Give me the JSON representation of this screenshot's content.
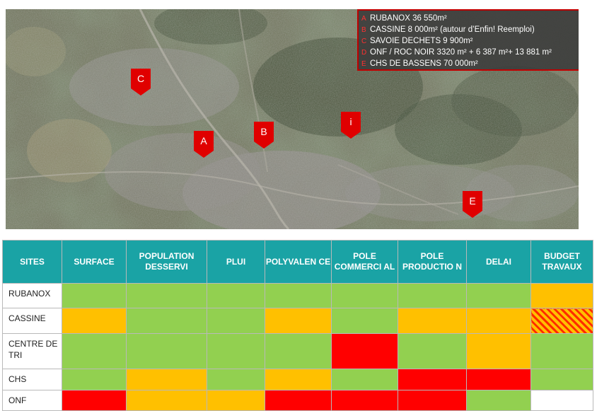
{
  "map": {
    "legend": [
      {
        "key": "A",
        "text": "RUBANOX 36 550m²"
      },
      {
        "key": "B",
        "text": "CASSINE 8 000m² (autour d’Enfin! Reemploi)"
      },
      {
        "key": "C",
        "text": "SAVOIE DECHETS 9 900m²"
      },
      {
        "key": "D",
        "text": "ONF / ROC NOIR 3320 m² + 6 387 m²+ 13 881 m²"
      },
      {
        "key": "E",
        "text": "CHS DE BASSENS 70 000m²"
      }
    ],
    "markers": [
      {
        "label": "C"
      },
      {
        "label": "A"
      },
      {
        "label": "B"
      },
      {
        "label": "i"
      },
      {
        "label": "E"
      }
    ]
  },
  "table": {
    "headers": [
      "SITES",
      "SURFACE",
      "POPULATION DESSERVI",
      "PLUI",
      "POLYVALEN CE",
      "POLE COMMERCI AL",
      "POLE PRODUCTIO N",
      "DELAI",
      "BUDGET TRAVAUX"
    ],
    "rows": [
      {
        "site": "RUBANOX",
        "cells": [
          "green",
          "green",
          "green",
          "green",
          "green",
          "green",
          "green",
          "orange"
        ]
      },
      {
        "site": "CASSINE",
        "cells": [
          "orange",
          "green",
          "green",
          "orange",
          "green",
          "orange",
          "orange",
          "hatched"
        ]
      },
      {
        "site": "CENTRE DE TRI",
        "cells": [
          "green",
          "green",
          "green",
          "green",
          "red",
          "green",
          "orange",
          "green"
        ]
      },
      {
        "site": "CHS",
        "cells": [
          "green",
          "orange",
          "green",
          "orange",
          "green",
          "red",
          "red",
          "green"
        ]
      },
      {
        "site": "ONF",
        "cells": [
          "red",
          "orange",
          "orange",
          "red",
          "red",
          "red",
          "green",
          "white"
        ]
      }
    ]
  },
  "colors": {
    "header_teal": "#1aa3a5",
    "green": "#92d050",
    "orange": "#ffc000",
    "red": "#ff0000",
    "marker_red": "#e00000",
    "legend_border": "#c00000"
  }
}
